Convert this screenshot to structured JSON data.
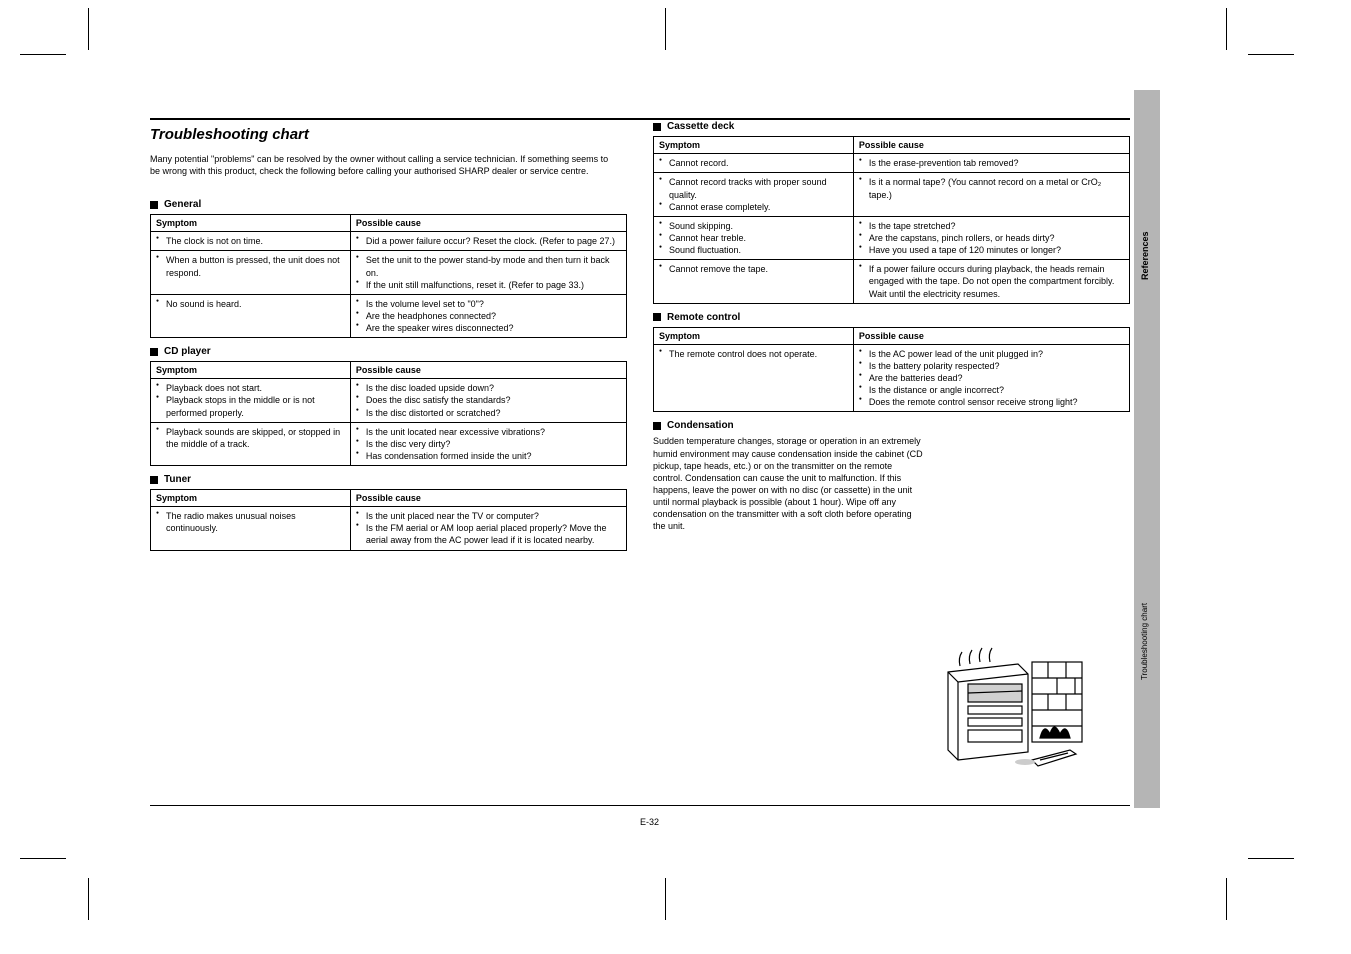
{
  "page": {
    "title": "Troubleshooting chart",
    "intro": "Many potential \"problems\" can be resolved by the owner without calling a service technician.\nIf something seems to be wrong with this product, check the following before calling your authorised SHARP dealer or service centre.",
    "number": "E-32"
  },
  "sections": {
    "general": {
      "title": "General",
      "headers": [
        "Symptom",
        "Possible cause"
      ],
      "rows": [
        {
          "s": [
            "The clock is not on time."
          ],
          "c": [
            "Did a power failure occur? Reset the clock. (Refer to page 27.)"
          ]
        },
        {
          "s": [
            "When a button is pressed, the unit does not respond."
          ],
          "c": [
            "Set the unit to the power stand-by mode and then turn it back on.",
            "If the unit still malfunctions, reset it. (Refer to page 33.)"
          ]
        },
        {
          "s": [
            "No sound is heard."
          ],
          "c": [
            "Is the volume level set to \"0\"?",
            "Are the headphones connected?",
            "Are the speaker wires disconnected?"
          ]
        }
      ]
    },
    "cd": {
      "title": "CD player",
      "headers": [
        "Symptom",
        "Possible cause"
      ],
      "rows": [
        {
          "s": [
            "Playback does not start.",
            "Playback stops in the middle or is not performed properly."
          ],
          "c": [
            "Is the disc loaded upside down?",
            "Does the disc satisfy the standards?",
            "Is the disc distorted or scratched?"
          ]
        },
        {
          "s": [
            "Playback sounds are skipped, or stopped in the middle of a track."
          ],
          "c": [
            "Is the unit located near excessive vibrations?",
            "Is the disc very dirty?",
            "Has condensation formed inside the unit?"
          ]
        }
      ]
    },
    "remote": {
      "title": "Remote control",
      "headers": [
        "Symptom",
        "Possible cause"
      ],
      "rows": [
        {
          "s": [
            "The remote control does not operate."
          ],
          "c": [
            "Is the AC power lead of the unit plugged in?",
            "Is the battery polarity respected?",
            "Are the batteries dead?",
            "Is the distance or angle incorrect?",
            "Does the remote control sensor receive strong light?"
          ]
        }
      ]
    },
    "cassette": {
      "title": "Cassette deck",
      "headers": [
        "Symptom",
        "Possible cause"
      ],
      "rows": [
        {
          "s": [
            "Cannot record."
          ],
          "c": [
            "Is the erase-prevention tab removed?"
          ]
        },
        {
          "s": [
            "Cannot record tracks with proper sound quality.",
            "Cannot erase completely."
          ],
          "c": [
            "Is it a normal tape? (You cannot record on a metal or CrO₂ tape.)"
          ]
        },
        {
          "s": [
            "Sound skipping.",
            "Cannot hear treble.",
            "Sound fluctuation."
          ],
          "c": [
            "Is the tape stretched?",
            "Are the capstans, pinch rollers, or heads dirty?",
            "Have you used a tape of 120 minutes or longer?"
          ]
        },
        {
          "s": [
            "Cannot remove the tape."
          ],
          "c": [
            "If a power failure occurs during playback, the heads remain engaged with the tape. Do not open the compartment forcibly. Wait until the electricity resumes."
          ]
        }
      ]
    },
    "tuner": {
      "title": "Tuner",
      "headers": [
        "Symptom",
        "Possible cause"
      ],
      "rows": [
        {
          "s": [
            "The radio makes unusual noises continuously."
          ],
          "c": [
            "Is the unit placed near the TV or computer?",
            "Is the FM aerial or AM loop aerial placed properly? Move the aerial away from the AC power lead if it is located nearby."
          ]
        }
      ]
    },
    "condensation": {
      "title": "Condensation",
      "text": "Sudden temperature changes, storage or operation in an extremely humid environment may cause condensation inside the cabinet (CD pickup, tape heads, etc.) or on the transmitter on the remote control. Condensation can cause the unit to malfunction. If this happens, leave the power on with no disc (or cassette) in the unit until normal playback is possible (about 1 hour). Wipe off any condensation on the transmitter with a soft cloth before operating the unit."
    }
  },
  "side": {
    "ref_label": "References",
    "page_label": "Troubleshooting chart"
  }
}
